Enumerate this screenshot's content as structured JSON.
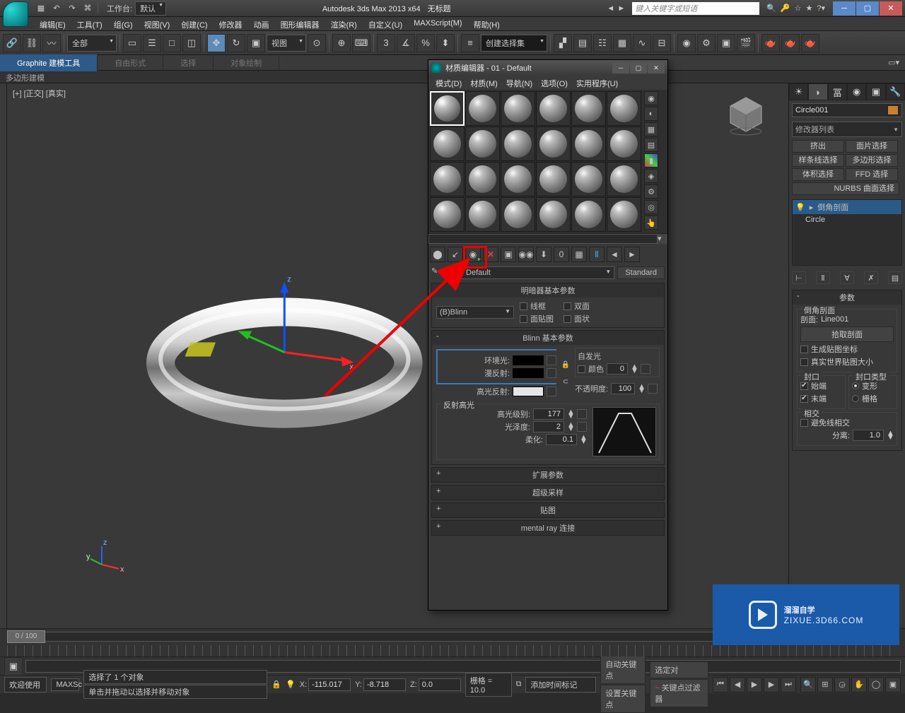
{
  "title": {
    "app": "Autodesk 3ds Max  2013 x64",
    "doc": "无标题",
    "search_placeholder": "键入关键字或短语"
  },
  "workspace": {
    "label": "工作台:",
    "value": "默认"
  },
  "menus": [
    "编辑(E)",
    "工具(T)",
    "组(G)",
    "视图(V)",
    "创建(C)",
    "修改器",
    "动画",
    "图形编辑器",
    "渲染(R)",
    "自定义(U)",
    "MAXScript(M)",
    "帮助(H)"
  ],
  "toolbar": {
    "allfilter": "全部",
    "refcoord": "视图",
    "createset": "创建选择集"
  },
  "ribbon": {
    "tabs": [
      "Graphite 建模工具",
      "自由形式",
      "选择",
      "对象绘制"
    ],
    "subbar": "多边形建模"
  },
  "viewport": {
    "label": "[+] [正交] [真实]"
  },
  "cmdpanel": {
    "objname": "Circle001",
    "modlist_placeholder": "修改器列表",
    "modbtns": [
      "挤出",
      "面片选择",
      "样条线选择",
      "多边形选择",
      "体积选择",
      "FFD 选择"
    ],
    "nurbs_label": "NURBS 曲面选择",
    "stack": {
      "mod": "倒角剖面",
      "base": "Circle"
    },
    "rollout_params": "参数",
    "bevel": {
      "group": "倒角剖面",
      "profile_label": "剖面:",
      "profile_name": "Line001",
      "pick": "拾取剖面",
      "gen_mapping": "生成贴图坐标",
      "real_world": "真实世界贴图大小"
    },
    "cap": {
      "group": "封口",
      "type_group": "封口类型",
      "start": "始端",
      "end": "末端",
      "morph": "变形",
      "grid": "栅格"
    },
    "intersect": {
      "group": "相交",
      "avoid": "避免线相交",
      "sep_label": "分离:",
      "sep_val": "1.0"
    }
  },
  "matdlg": {
    "title": "材质编辑器 - 01 - Default",
    "menus": [
      "模式(D)",
      "材质(M)",
      "导航(N)",
      "选项(O)",
      "实用程序(U)"
    ],
    "matname": "01 - Default",
    "mattype": "Standard",
    "rollout_shader": "明暗器基本参数",
    "shader": "(B)Blinn",
    "wire": "线框",
    "twosided": "双面",
    "facemap": "面贴图",
    "faceted": "面状",
    "rollout_blinn": "Blinn 基本参数",
    "ambient": "环境光:",
    "diffuse": "漫反射:",
    "specular_c": "高光反射:",
    "selfillum_group": "自发光",
    "selfillum_color": "颜色",
    "selfillum_val": "0",
    "opacity": "不透明度:",
    "opacity_val": "100",
    "spec_group": "反射高光",
    "spec_level": "高光级别:",
    "spec_level_val": "177",
    "gloss": "光泽度:",
    "gloss_val": "2",
    "soften": "柔化:",
    "soften_val": "0.1",
    "rollouts_collapsed": [
      "扩展参数",
      "超级采样",
      "贴图",
      "mental ray 连接"
    ]
  },
  "bottom": {
    "frame": "0 / 100",
    "welcome": "欢迎使用",
    "maxsc": "MAXSc",
    "sel_count": "选择了 1 个对象",
    "prompt": "单击并拖动以选择并移动对象",
    "x": "X:",
    "xv": "-115.017",
    "y": "Y:",
    "yv": "-8.718",
    "z": "Z:",
    "zv": "0.0",
    "grid": "栅格 = 10.0",
    "addtime": "添加时间标记",
    "autokey": "自动关键点",
    "selsel": "选定对",
    "setkey": "设置关键点",
    "keyfilter": "关键点过滤器"
  },
  "watermark": {
    "brand": "溜溜自学",
    "url": "ZIXUE.3D66.COM"
  }
}
